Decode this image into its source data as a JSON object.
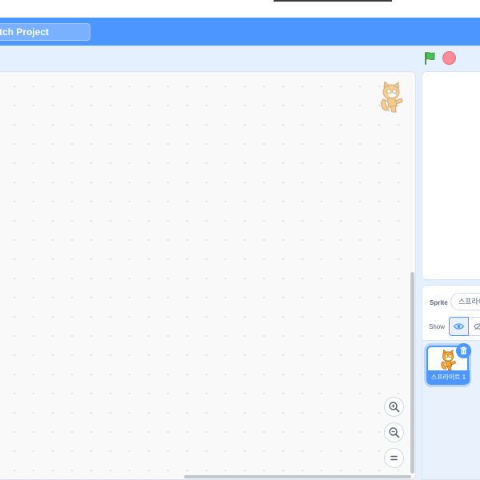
{
  "menubar": {
    "project_title": "tch Project"
  },
  "toolbar": {
    "green_flag_icon": "green-flag-icon",
    "stop_icon": "stop-icon"
  },
  "code_area": {
    "zoom_in_icon": "zoom-in-icon",
    "zoom_out_icon": "zoom-out-icon",
    "zoom_reset_icon": "zoom-reset-icon"
  },
  "sprite_info": {
    "sprite_label": "Sprite",
    "sprite_name_value": "스프라이",
    "show_label": "Show"
  },
  "sprite_list": {
    "items": [
      {
        "name": "스프라이트 1",
        "selected": true
      }
    ]
  },
  "colors": {
    "accent": "#4c97ff",
    "menubar": "#4c97ff",
    "background": "#e5f0ff",
    "flag_green": "#4cbf56",
    "stop_red": "#ff8c9a"
  }
}
